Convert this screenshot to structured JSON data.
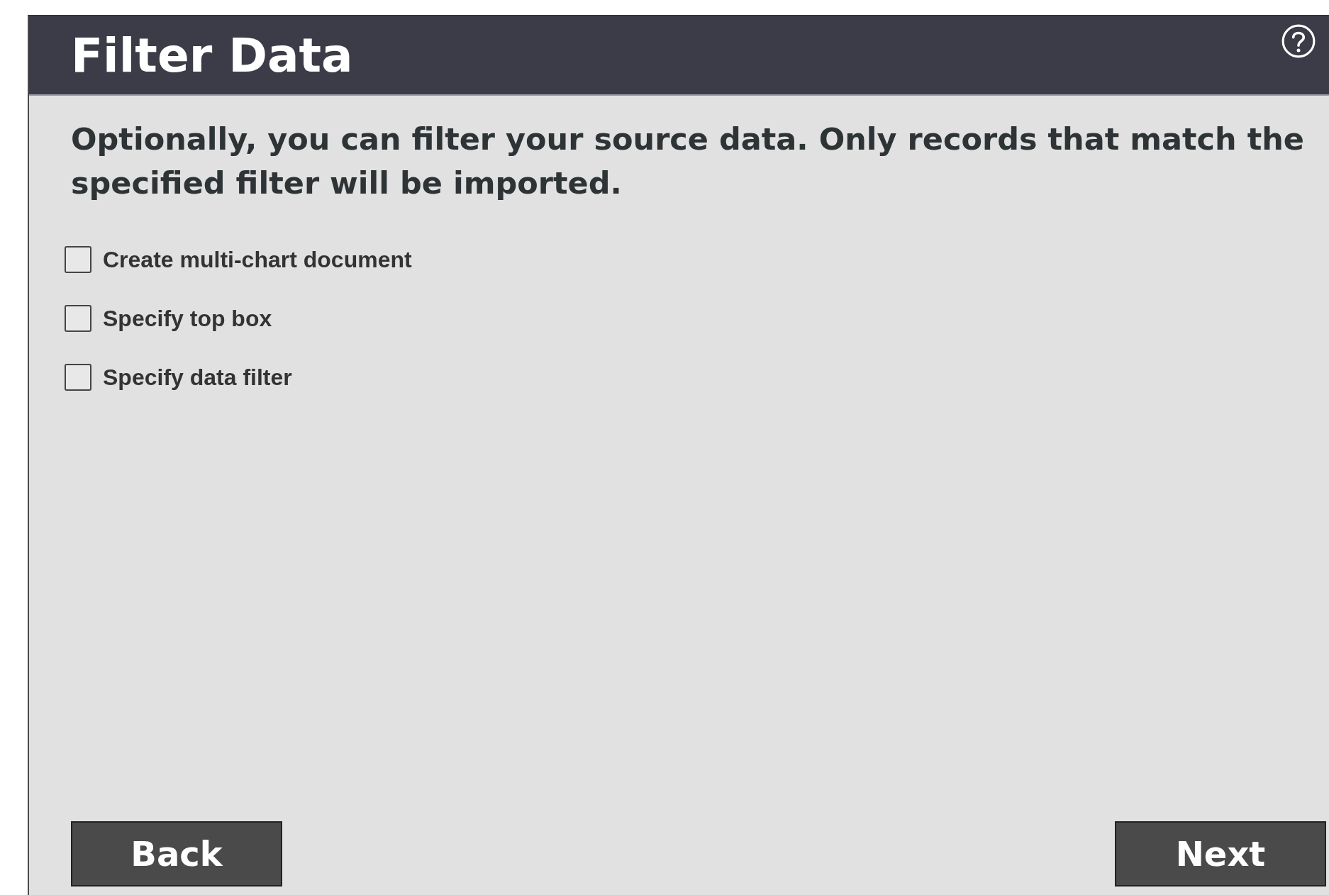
{
  "dialog": {
    "title": "Filter Data",
    "description": "Optionally, you can filter your source data. Only records that match the specified filter will be imported.",
    "options": [
      {
        "label": "Create multi-chart document",
        "checked": false
      },
      {
        "label": "Specify top box",
        "checked": false
      },
      {
        "label": "Specify data filter",
        "checked": false
      }
    ],
    "buttons": {
      "back": "Back",
      "next": "Next"
    }
  }
}
